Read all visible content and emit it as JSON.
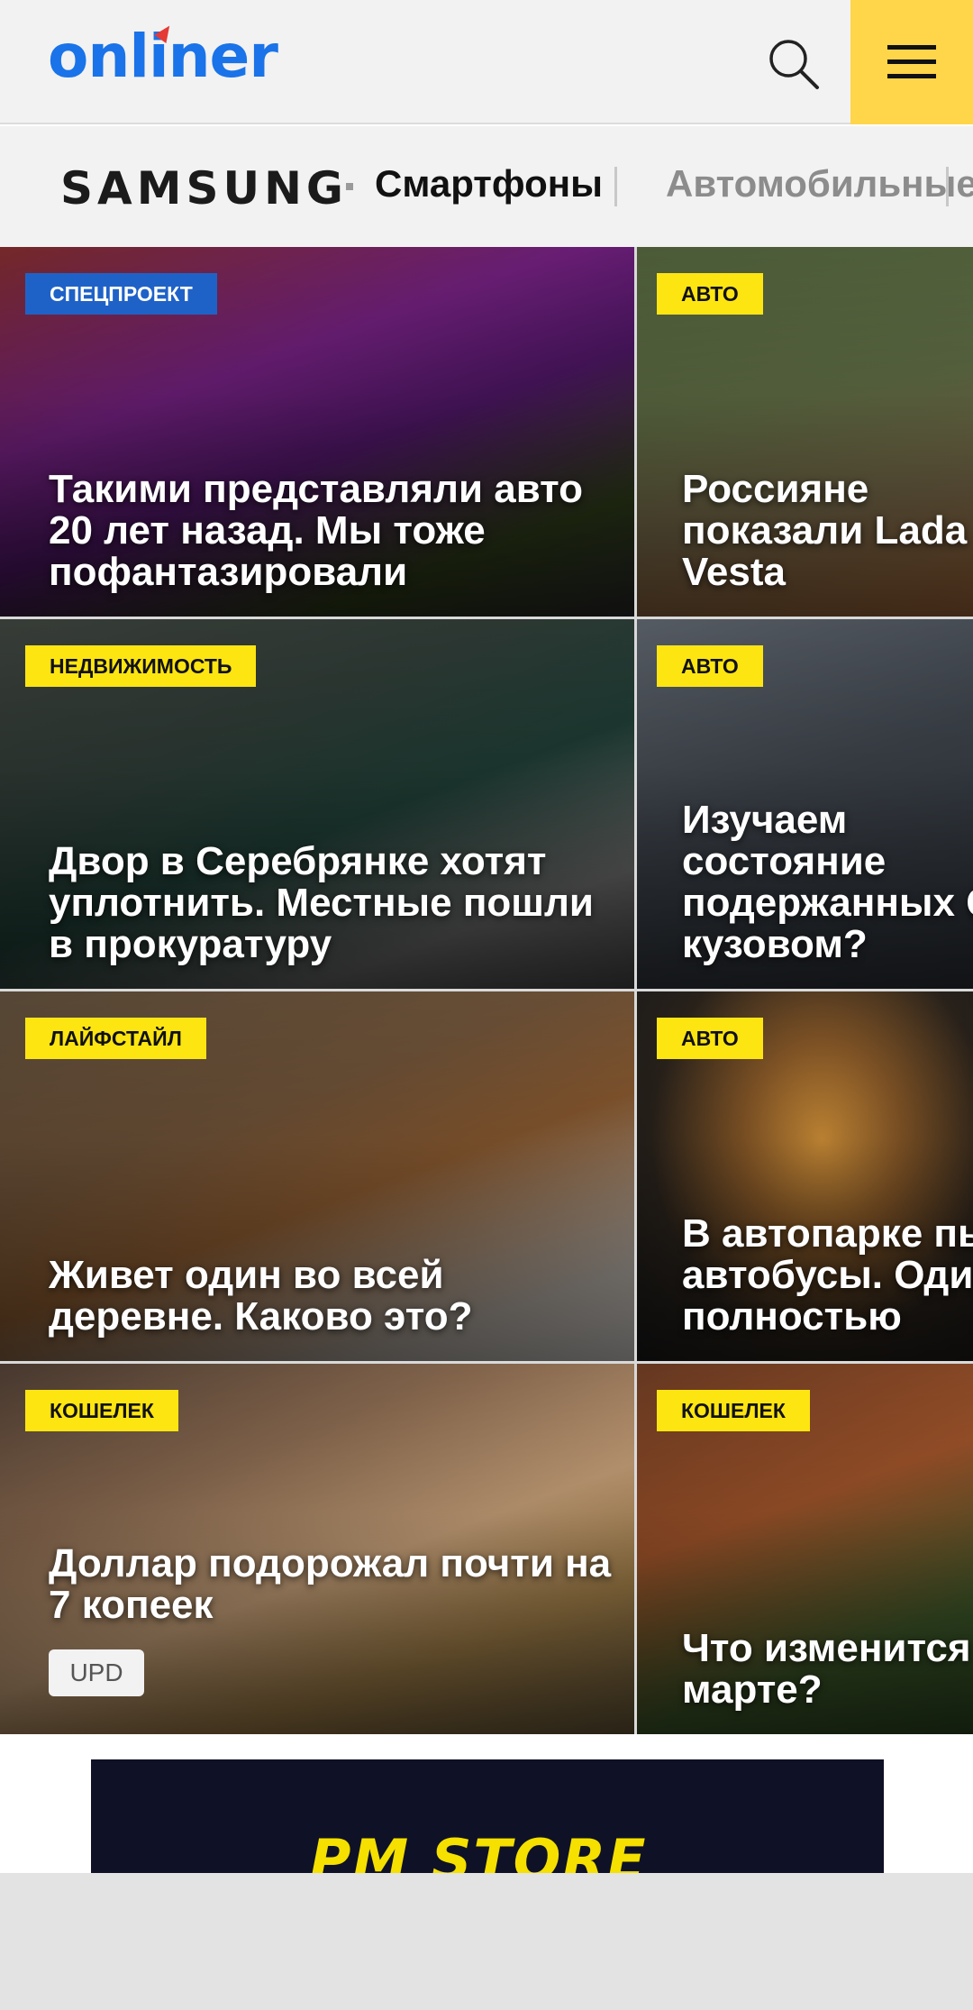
{
  "header": {
    "logo": "onliner",
    "search_icon": "search-icon",
    "menu_icon": "hamburger-menu-icon"
  },
  "subnav": {
    "brand": "SAMSUNG",
    "items": [
      "Смартфоны",
      "Автомобильные"
    ]
  },
  "cards": [
    {
      "tag": "СПЕЦПРОЕКТ",
      "tag_color": "#1f62c7",
      "title": "Такими представляли авто 20 лет назад. Мы тоже пофантазировали"
    },
    {
      "tag": "АВТО",
      "tag_color": "#fde512",
      "title": "Россияне показали Lada Vesta"
    },
    {
      "tag": "НЕДВИЖИМОСТЬ",
      "tag_color": "#fde512",
      "title": "Двор в Серебрянке хотят уплотнить. Местные пошли в прокуратуру"
    },
    {
      "tag": "АВТО",
      "tag_color": "#fde512",
      "title": "Изучаем состояние подержанных Ge кузовом?"
    },
    {
      "tag": "ЛАЙФСТАЙЛ",
      "tag_color": "#fde512",
      "title": "Живет один во всей деревне. Каково это?"
    },
    {
      "tag": "АВТО",
      "tag_color": "#fde512",
      "title": "В автопарке пыл автобусы. Один с полностью"
    },
    {
      "tag": "КОШЕЛЕК",
      "tag_color": "#fde512",
      "title": "Доллар подорожал почти на 7 копеек",
      "extra": "UPD"
    },
    {
      "tag": "КОШЕЛЕК",
      "tag_color": "#fde512",
      "title": "Что изменится в марте?"
    }
  ],
  "banner": {
    "text": "PM STORE"
  },
  "colors": {
    "accent_blue": "#1a73e8",
    "menu_yellow": "#ffd54a",
    "tag_yellow": "#fde512",
    "tag_blue": "#1f62c7"
  }
}
